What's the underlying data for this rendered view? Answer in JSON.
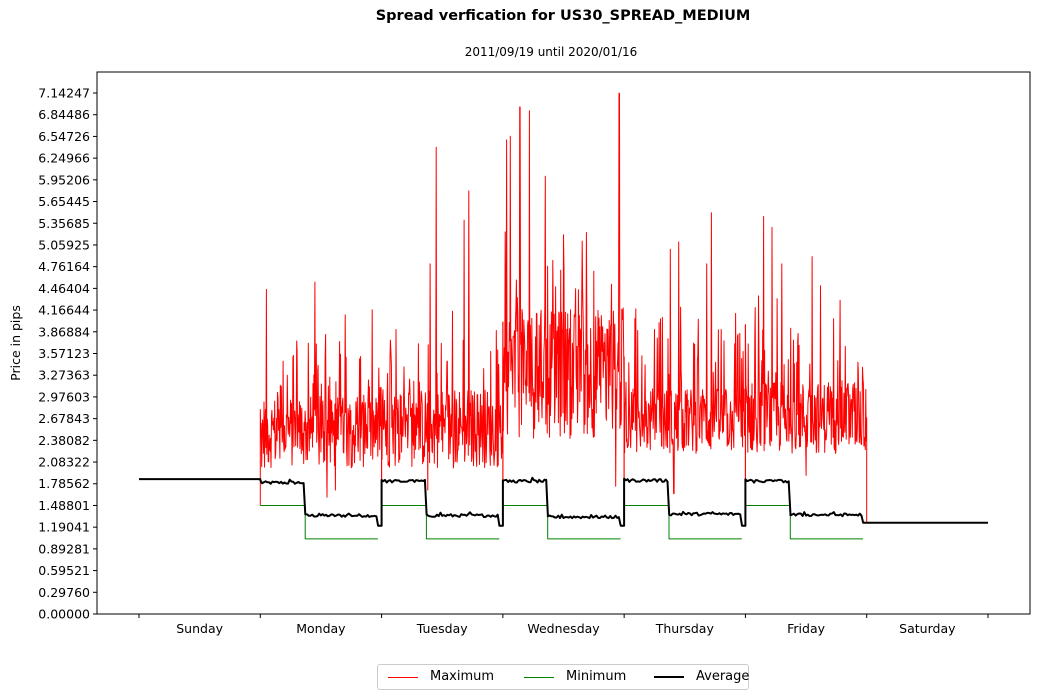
{
  "chart_data": {
    "type": "line",
    "title": "Spread verfication for US30_SPREAD_MEDIUM",
    "subtitle": "2011/09/19 until 2020/01/16",
    "xlabel": "",
    "ylabel": "Price in pips",
    "ylim": [
      0.0,
      7.44
    ],
    "xlim_days": [
      -0.345,
      7.345
    ],
    "grid": false,
    "legend_position": "bottom-center",
    "y_ticks": [
      "0.00000",
      "0.29760",
      "0.59521",
      "0.89281",
      "1.19041",
      "1.48801",
      "1.78562",
      "2.08322",
      "2.38082",
      "2.67843",
      "2.97603",
      "3.27363",
      "3.57123",
      "3.86884",
      "4.16644",
      "4.46404",
      "4.76164",
      "5.05925",
      "5.35685",
      "5.65445",
      "5.95206",
      "6.24966",
      "6.54726",
      "6.84486",
      "7.14247"
    ],
    "x_tick_positions_days": [
      0,
      1,
      2,
      3,
      4,
      5,
      6,
      7
    ],
    "x_tick_labels": [
      "Sunday",
      "Monday",
      "Tuesday",
      "Wednesday",
      "Thursday",
      "Friday",
      "Saturday"
    ],
    "series": [
      {
        "name": "Maximum",
        "color": "#ff0000",
        "width": 1
      },
      {
        "name": "Minimum",
        "color": "#008000",
        "width": 1
      },
      {
        "name": "Average",
        "color": "#000000",
        "width": 2
      }
    ],
    "weekend_flat": {
      "sunday_average": 1.85,
      "saturday_average": 1.25
    },
    "trading_days": [
      {
        "day": "Monday",
        "start": 1,
        "session1_end": 1.37,
        "session2_end": 1.97,
        "end": 2.0,
        "min_session1": 1.488,
        "min_session2": 1.03,
        "avg_session1": 1.8,
        "avg_session2": 1.35,
        "avg_dip": 1.21,
        "max_base": [
          2.0,
          3.0
        ],
        "max_peaks": [
          [
            1.05,
            4.45
          ],
          [
            1.45,
            4.55
          ],
          [
            1.55,
            4.4
          ],
          [
            1.7,
            4.1
          ],
          [
            1.82,
            3.5
          ]
        ],
        "max_low_dips": [
          [
            1.55,
            1.6
          ],
          [
            1.62,
            1.7
          ]
        ]
      },
      {
        "day": "Tuesday",
        "start": 2,
        "session1_end": 2.37,
        "session2_end": 2.97,
        "end": 3.0,
        "min_session1": 1.488,
        "min_session2": 1.03,
        "avg_session1": 1.82,
        "avg_session2": 1.35,
        "avg_dip": 1.21,
        "max_base": [
          2.0,
          3.1
        ],
        "max_peaks": [
          [
            2.12,
            3.9
          ],
          [
            2.4,
            4.8
          ],
          [
            2.45,
            6.4
          ],
          [
            2.68,
            5.4
          ],
          [
            2.72,
            5.8
          ],
          [
            2.9,
            3.6
          ]
        ],
        "max_low_dips": [
          [
            2.38,
            1.7
          ]
        ]
      },
      {
        "day": "Wednesday",
        "start": 3,
        "session1_end": 3.37,
        "session2_end": 3.97,
        "end": 4.0,
        "min_session1": 1.488,
        "min_session2": 1.03,
        "avg_session1": 1.82,
        "avg_session2": 1.33,
        "avg_dip": 1.21,
        "max_base": [
          2.4,
          4.2
        ],
        "max_peaks": [
          [
            3.03,
            6.5
          ],
          [
            3.06,
            6.55
          ],
          [
            3.14,
            6.95
          ],
          [
            3.22,
            6.9
          ],
          [
            3.35,
            6.0
          ],
          [
            3.5,
            5.2
          ],
          [
            3.75,
            4.7
          ],
          [
            3.96,
            7.14
          ]
        ],
        "max_low_dips": [
          [
            3.93,
            1.75
          ]
        ]
      },
      {
        "day": "Thursday",
        "start": 4,
        "session1_end": 4.37,
        "session2_end": 4.97,
        "end": 5.0,
        "min_session1": 1.488,
        "min_session2": 1.03,
        "avg_session1": 1.83,
        "avg_session2": 1.37,
        "avg_dip": 1.21,
        "max_base": [
          2.2,
          3.1
        ],
        "max_peaks": [
          [
            4.25,
            3.9
          ],
          [
            4.38,
            5.0
          ],
          [
            4.45,
            5.1
          ],
          [
            4.72,
            5.5
          ],
          [
            4.68,
            4.8
          ],
          [
            4.8,
            3.9
          ]
        ],
        "max_low_dips": [
          [
            4.41,
            1.65
          ]
        ]
      },
      {
        "day": "Friday",
        "start": 5,
        "session1_end": 5.37,
        "session2_end": 5.97,
        "end": 6.0,
        "min_session1": 1.488,
        "min_session2": 1.03,
        "avg_session1": 1.82,
        "avg_session2": 1.36,
        "avg_dip": 1.25,
        "max_base": [
          2.2,
          3.2
        ],
        "max_peaks": [
          [
            5.08,
            4.2
          ],
          [
            5.15,
            5.45
          ],
          [
            5.22,
            5.3
          ],
          [
            5.3,
            4.8
          ],
          [
            5.55,
            4.9
          ],
          [
            5.62,
            4.5
          ],
          [
            5.78,
            4.3
          ]
        ],
        "max_low_dips": [
          [
            5.5,
            1.9
          ]
        ]
      }
    ]
  }
}
